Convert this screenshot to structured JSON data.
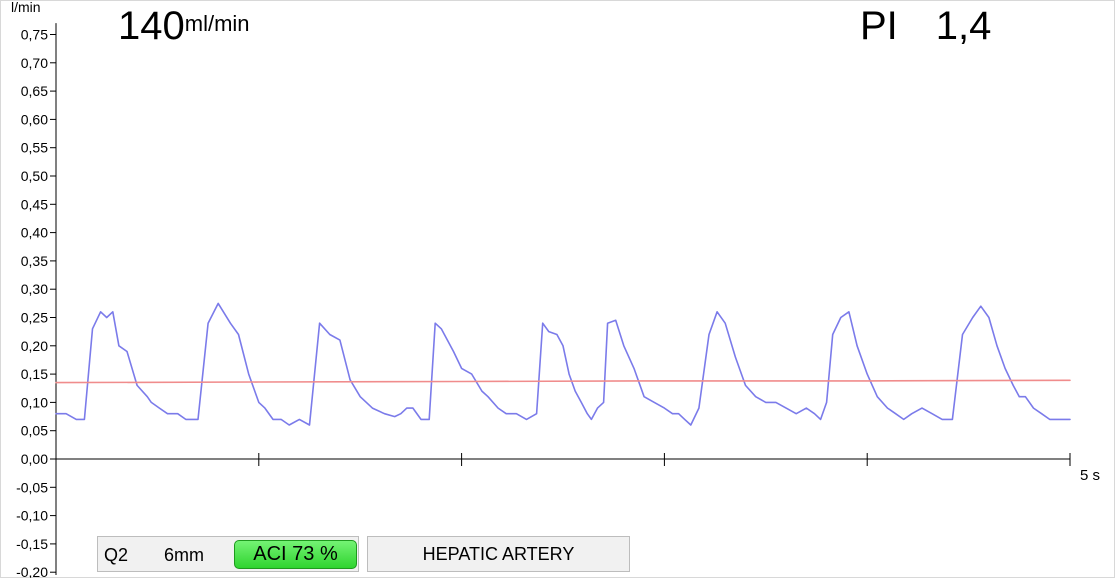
{
  "readout": {
    "flow_value": "140",
    "flow_unit": "ml/min",
    "pi_label": "PI",
    "pi_value": "1,4"
  },
  "chart_data": {
    "type": "line",
    "ylabel": "l/min",
    "xlabel": "5 s",
    "ylim": [
      -0.2,
      0.77
    ],
    "xlim": [
      0,
      5
    ],
    "grid": false,
    "y_ticks": [
      "0,75",
      "0,70",
      "0,65",
      "0,60",
      "0,55",
      "0,50",
      "0,45",
      "0,40",
      "0,35",
      "0,30",
      "0,25",
      "0,20",
      "0,15",
      "0,10",
      "0,05",
      "0,00",
      "-0,05",
      "-0,10",
      "-0,15",
      "-0,20"
    ],
    "y_tick_values": [
      0.75,
      0.7,
      0.65,
      0.6,
      0.55,
      0.5,
      0.45,
      0.4,
      0.35,
      0.3,
      0.25,
      0.2,
      0.15,
      0.1,
      0.05,
      0.0,
      -0.05,
      -0.1,
      -0.15,
      -0.2
    ],
    "x_tick_positions": [
      1,
      2,
      3,
      4,
      5
    ],
    "x_end_label": "5 s",
    "series": [
      {
        "color": "#7b7bea",
        "x": [
          0,
          0.05,
          0.1,
          0.14,
          0.18,
          0.22,
          0.25,
          0.28,
          0.31,
          0.35,
          0.4,
          0.45,
          0.47,
          0.51,
          0.55,
          0.6,
          0.64,
          0.7,
          0.75,
          0.8,
          0.86,
          0.9,
          0.95,
          1.0,
          1.03,
          1.07,
          1.11,
          1.15,
          1.2,
          1.25,
          1.3,
          1.35,
          1.4,
          1.45,
          1.5,
          1.56,
          1.62,
          1.67,
          1.7,
          1.73,
          1.76,
          1.8,
          1.84,
          1.87,
          1.9,
          1.93,
          1.96,
          2.0,
          2.05,
          2.1,
          2.13,
          2.18,
          2.22,
          2.27,
          2.32,
          2.37,
          2.4,
          2.43,
          2.47,
          2.5,
          2.53,
          2.56,
          2.59,
          2.62,
          2.64,
          2.67,
          2.7,
          2.72,
          2.76,
          2.8,
          2.85,
          2.9,
          2.95,
          3.0,
          3.04,
          3.07,
          3.1,
          3.13,
          3.17,
          3.22,
          3.26,
          3.3,
          3.35,
          3.4,
          3.45,
          3.5,
          3.55,
          3.6,
          3.65,
          3.7,
          3.74,
          3.77,
          3.8,
          3.83,
          3.87,
          3.91,
          3.95,
          4.0,
          4.05,
          4.1,
          4.14,
          4.18,
          4.22,
          4.27,
          4.32,
          4.37,
          4.42,
          4.47,
          4.52,
          4.56,
          4.6,
          4.64,
          4.68,
          4.72,
          4.75,
          4.78,
          4.82,
          4.86,
          4.9,
          4.94,
          5.0
        ],
        "values": [
          0.08,
          0.08,
          0.07,
          0.07,
          0.23,
          0.26,
          0.25,
          0.26,
          0.2,
          0.19,
          0.13,
          0.11,
          0.1,
          0.09,
          0.08,
          0.08,
          0.07,
          0.07,
          0.24,
          0.275,
          0.24,
          0.22,
          0.15,
          0.1,
          0.09,
          0.07,
          0.07,
          0.06,
          0.07,
          0.06,
          0.24,
          0.22,
          0.21,
          0.14,
          0.11,
          0.09,
          0.08,
          0.075,
          0.08,
          0.09,
          0.09,
          0.07,
          0.07,
          0.24,
          0.23,
          0.21,
          0.19,
          0.16,
          0.15,
          0.12,
          0.11,
          0.09,
          0.08,
          0.08,
          0.07,
          0.08,
          0.24,
          0.225,
          0.22,
          0.2,
          0.15,
          0.12,
          0.1,
          0.08,
          0.07,
          0.09,
          0.1,
          0.24,
          0.245,
          0.2,
          0.16,
          0.11,
          0.1,
          0.09,
          0.08,
          0.08,
          0.07,
          0.06,
          0.09,
          0.22,
          0.26,
          0.24,
          0.18,
          0.13,
          0.11,
          0.1,
          0.1,
          0.09,
          0.08,
          0.09,
          0.08,
          0.07,
          0.1,
          0.22,
          0.25,
          0.26,
          0.2,
          0.15,
          0.11,
          0.09,
          0.08,
          0.07,
          0.08,
          0.09,
          0.08,
          0.07,
          0.07,
          0.22,
          0.25,
          0.27,
          0.25,
          0.2,
          0.16,
          0.13,
          0.11,
          0.11,
          0.09,
          0.08,
          0.07,
          0.07,
          0.07
        ]
      },
      {
        "color": "#f08c8c",
        "x": [
          0,
          1.0,
          2.0,
          3.0,
          4.0,
          5.0
        ],
        "values": [
          0.135,
          0.136,
          0.137,
          0.138,
          0.138,
          0.139
        ]
      }
    ]
  },
  "status_bar": {
    "probe": "Q2",
    "size": "6mm",
    "aci": "ACI 73 %",
    "vessel": "HEPATIC ARTERY"
  },
  "colors": {
    "flow_trace": "#7b7bea",
    "mean_trace": "#f08c8c",
    "aci_badge": "#3ddc3d"
  }
}
